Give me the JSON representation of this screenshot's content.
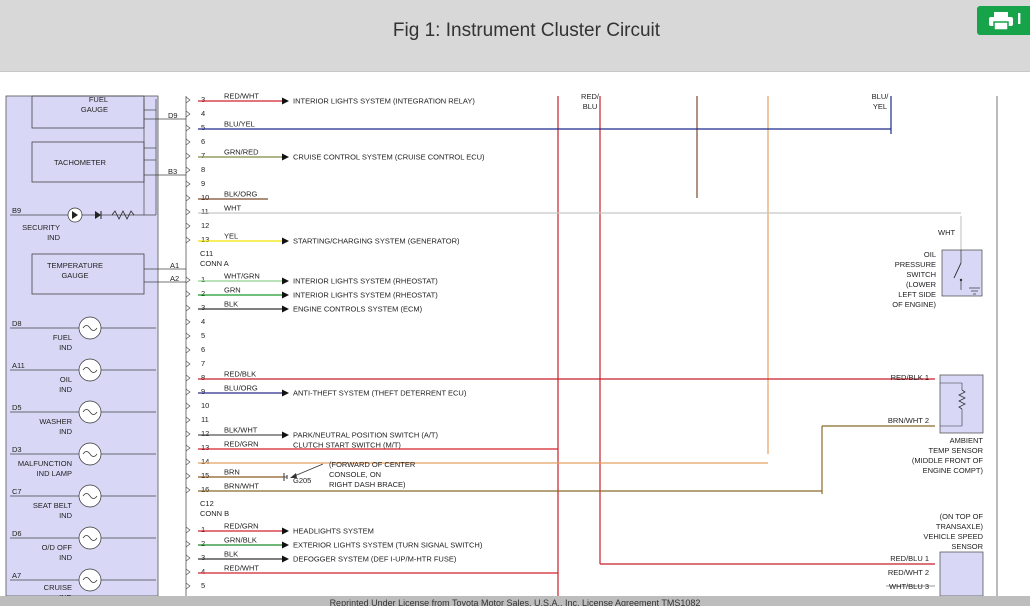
{
  "header": {
    "title": "Fig 1: Instrument Cluster Circuit",
    "print_icon": "printer-icon",
    "print_letter": "I",
    "accent": "#17a34a"
  },
  "footer": {
    "text": "Reprinted Under License from Toyota Motor Sales, U.S.A., Inc. License Agreement TMS1082"
  },
  "cluster": {
    "fuel_gauge": "FUEL\nGAUGE",
    "tachometer": "TACHOMETER",
    "temperature_gauge": "TEMPERATURE\nGAUGE",
    "security_ind": "SECURITY\nIND",
    "fuel_ind": "FUEL\nIND",
    "oil_ind": "OIL\nIND",
    "washer_ind": "WASHER\nIND",
    "malfunction_ind": "MALFUNCTION\nIND LAMP",
    "seat_belt_ind": "SEAT BELT\nIND",
    "od_off_ind": "O/D OFF\nIND",
    "cruise_ind": "CRUISE\nIND",
    "pins": {
      "d9": "D9",
      "b3": "B3",
      "b9": "B9",
      "a1": "A1",
      "a2": "A2",
      "d8": "D8",
      "a11": "A11",
      "d5": "D5",
      "d3": "D3",
      "c7": "C7",
      "d6": "D6",
      "a7": "A7"
    }
  },
  "connectors": {
    "c11": "C11\nCONN A",
    "c12": "C12\nCONN B"
  },
  "ground": {
    "g205": "G205",
    "note": "(FORWARD OF CENTER\nCONSOLE, ON\nRIGHT DASH BRACE)"
  },
  "top_labels": {
    "red_blu": "RED/\nBLU",
    "blu_yel": "BLU/\nYEL",
    "wht": "WHT"
  },
  "oil_switch": "OIL\nPRESSURE\nSWITCH\n(LOWER\nLEFT SIDE\nOF ENGINE)",
  "ambient_sensor": "AMBIENT\nTEMP SENSOR\n(MIDDLE FRONT OF\nENGINE COMPT)",
  "ambient_pins": {
    "p1": "RED/BLK  1",
    "p2": "BRN/WHT  2"
  },
  "vss": "(ON TOP OF\nTRANSAXLE)\nVEHICLE SPEED\nSENSOR",
  "vss_pins": {
    "p1": "RED/BLU  1",
    "p2": "RED/WHT  2",
    "p3": "WHT/BLU  3"
  },
  "rows": [
    {
      "n": "3",
      "wire": "RED/WHT",
      "dest": "INTERIOR LIGHTS SYSTEM (INTEGRATION RELAY)",
      "color": "#d0202a"
    },
    {
      "n": "4",
      "wire": "",
      "dest": "",
      "color": ""
    },
    {
      "n": "5",
      "wire": "BLU/YEL",
      "dest": "",
      "color": "#1c2a8c"
    },
    {
      "n": "6",
      "wire": "",
      "dest": "",
      "color": ""
    },
    {
      "n": "7",
      "wire": "GRN/RED",
      "dest": "CRUISE CONTROL SYSTEM (CRUISE CONTROL ECU)",
      "color": "#7a8a40"
    },
    {
      "n": "8",
      "wire": "",
      "dest": "",
      "color": ""
    },
    {
      "n": "9",
      "wire": "",
      "dest": "",
      "color": ""
    },
    {
      "n": "10",
      "wire": "BLK/ORG",
      "dest": "",
      "color": "#7a4a2a"
    },
    {
      "n": "11",
      "wire": "WHT",
      "dest": "",
      "color": "#c8c8c8"
    },
    {
      "n": "12",
      "wire": "",
      "dest": "",
      "color": ""
    },
    {
      "n": "13",
      "wire": "YEL",
      "dest": "STARTING/CHARGING SYSTEM (GENERATOR)",
      "color": "#f2e200"
    },
    {
      "n": "1",
      "wire": "WHT/GRN",
      "dest": "INTERIOR LIGHTS SYSTEM (RHEOSTAT)",
      "color": "#8fd08f"
    },
    {
      "n": "2",
      "wire": "GRN",
      "dest": "INTERIOR LIGHTS SYSTEM (RHEOSTAT)",
      "color": "#1a9a2a"
    },
    {
      "n": "3",
      "wire": "BLK",
      "dest": "ENGINE CONTROLS SYSTEM (ECM)",
      "color": "#333333"
    },
    {
      "n": "4",
      "wire": "",
      "dest": "",
      "color": ""
    },
    {
      "n": "5",
      "wire": "",
      "dest": "",
      "color": ""
    },
    {
      "n": "6",
      "wire": "",
      "dest": "",
      "color": ""
    },
    {
      "n": "7",
      "wire": "",
      "dest": "",
      "color": ""
    },
    {
      "n": "8",
      "wire": "RED/BLK",
      "dest": "",
      "color": "#c81e2a"
    },
    {
      "n": "9",
      "wire": "BLU/ORG",
      "dest": "ANTI-THEFT SYSTEM (THEFT DETERRENT ECU)",
      "color": "#2a2a8c"
    },
    {
      "n": "10",
      "wire": "",
      "dest": "",
      "color": ""
    },
    {
      "n": "11",
      "wire": "",
      "dest": "",
      "color": ""
    },
    {
      "n": "12",
      "wire": "BLK/WHT",
      "dest": "PARK/NEUTRAL POSITION SWITCH (A/T)\nCLUTCH START SWITCH (M/T)",
      "color": "#555555"
    },
    {
      "n": "13",
      "wire": "RED/GRN",
      "dest": "",
      "color": "#d0202a"
    },
    {
      "n": "14",
      "wire": "",
      "dest": "",
      "color": "#e2a060"
    },
    {
      "n": "15",
      "wire": "BRN",
      "dest": "",
      "color": "#8a5a20"
    },
    {
      "n": "16",
      "wire": "BRN/WHT",
      "dest": "",
      "color": "#8a6a2a"
    },
    {
      "n": "1",
      "wire": "RED/GRN",
      "dest": "HEADLIGHTS SYSTEM",
      "color": "#d0202a"
    },
    {
      "n": "2",
      "wire": "GRN/BLK",
      "dest": "EXTERIOR LIGHTS SYSTEM (TURN SIGNAL SWITCH)",
      "color": "#1a8a2a"
    },
    {
      "n": "3",
      "wire": "BLK",
      "dest": "DEFOGGER SYSTEM (DEF I-UP/M-HTR FUSE)",
      "color": "#333333"
    },
    {
      "n": "4",
      "wire": "RED/WHT",
      "dest": "",
      "color": "#d0202a"
    },
    {
      "n": "5",
      "wire": "",
      "dest": "",
      "color": ""
    }
  ]
}
